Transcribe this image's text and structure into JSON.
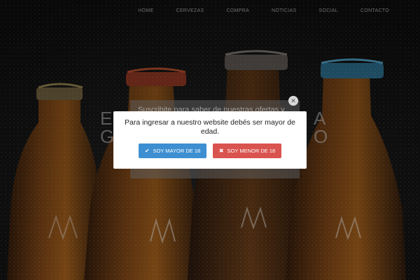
{
  "nav": {
    "items": [
      "HOME",
      "CERVEZAS",
      "COMPRA",
      "NOTICIAS",
      "SOCIAL",
      "CONTACTO"
    ]
  },
  "background": {
    "heading_left_1": "E",
    "heading_right_1": "A",
    "heading_left_2": "G",
    "heading_right_2": "O"
  },
  "newsletter": {
    "text": "Suscribite para saber de nuestras ofertas y",
    "close_icon": "close-icon"
  },
  "age_gate": {
    "message": "Para ingresar a nuestro website debés ser mayor de edad.",
    "yes_label": "SOY MAYOR DE 18",
    "no_label": "SOY MENOR DE 18",
    "yes_icon": "check-icon",
    "no_icon": "close-icon",
    "yes_color": "#3d8fd1",
    "no_color": "#d9534f"
  }
}
